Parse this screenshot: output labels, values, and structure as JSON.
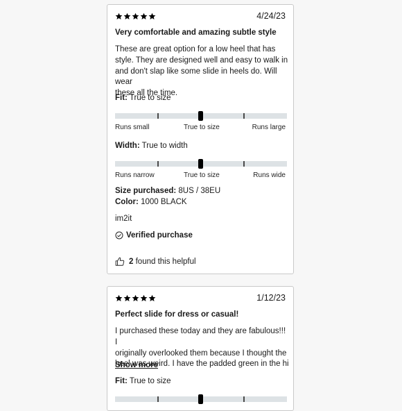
{
  "reviews": [
    {
      "rating": 5,
      "date": "4/24/23",
      "title": "Very comfortable and amazing subtle style",
      "body_lines": [
        "These are great option for a low heel that has",
        "style. They are designed well and easy to walk in",
        "and don't slap like some slide in heels do. Will wear",
        "these all the time."
      ],
      "fit": {
        "label": "Fit:",
        "value": "True to size",
        "scale": [
          "Runs small",
          "True to size",
          "Runs large"
        ],
        "position": 0.5
      },
      "width": {
        "label": "Width:",
        "value": "True to width",
        "scale": [
          "Runs narrow",
          "True to size",
          "Runs wide"
        ],
        "position": 0.5
      },
      "size_purchased": {
        "label": "Size purchased:",
        "value": "8US / 38EU"
      },
      "color": {
        "label": "Color:",
        "value": "1000 BLACK"
      },
      "username": "im2it",
      "verified": "Verified purchase",
      "helpful": {
        "count": "2",
        "text": "found this helpful"
      }
    },
    {
      "rating": 5,
      "date": "1/12/23",
      "title": "Perfect slide for dress or casual!",
      "body_lines": [
        "I purchased these today and they are fabulous!!! I",
        "originally overlooked them because I thought the",
        "heel was weird. I have the padded green in the hi..."
      ],
      "show_more": "Show more",
      "fit": {
        "label": "Fit:",
        "value": "True to size",
        "position": 0.5
      }
    }
  ],
  "colors": {
    "star": "#000000",
    "track": "#dde2e5",
    "tick": "#4a4a4a",
    "border": "#c9c9c9"
  },
  "icons": {
    "star": "star-icon",
    "verified": "check-circle-icon",
    "helpful": "thumbs-up-icon"
  }
}
